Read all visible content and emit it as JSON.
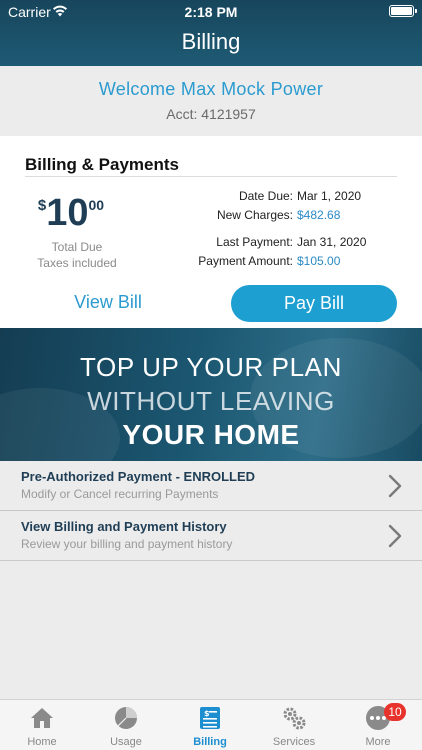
{
  "status_bar": {
    "carrier": "Carrier",
    "time": "2:18 PM"
  },
  "header": {
    "title": "Billing"
  },
  "welcome": {
    "name": "Welcome Max Mock Power",
    "account": "Acct: 4121957"
  },
  "billing": {
    "section_title": "Billing & Payments",
    "amount_currency": "$",
    "amount_dollars": "10",
    "amount_cents": "00",
    "total_due_label": "Total Due",
    "taxes_label": "Taxes included",
    "date_due_label": "Date Due:",
    "date_due_value": "Mar 1, 2020",
    "new_charges_label": "New Charges:",
    "new_charges_value": "$482.68",
    "last_payment_label": "Last Payment:",
    "last_payment_value": "Jan 31, 2020",
    "payment_amount_label": "Payment Amount:",
    "payment_amount_value": "$105.00",
    "view_bill_label": "View Bill",
    "pay_bill_label": "Pay Bill"
  },
  "banner": {
    "line1": "TOP UP YOUR PLAN",
    "line2": "WITHOUT LEAVING",
    "line3": "YOUR HOME"
  },
  "list": [
    {
      "title": "Pre-Authorized Payment - ENROLLED",
      "subtitle": "Modify or Cancel recurring Payments"
    },
    {
      "title": "View Billing and Payment History",
      "subtitle": "Review your billing and payment history"
    }
  ],
  "tabs": [
    {
      "label": "Home",
      "icon": "home-icon"
    },
    {
      "label": "Usage",
      "icon": "pie-chart-icon"
    },
    {
      "label": "Billing",
      "icon": "bill-icon",
      "active": true
    },
    {
      "label": "Services",
      "icon": "gears-icon"
    },
    {
      "label": "More",
      "icon": "more-icon",
      "badge": "10"
    }
  ],
  "colors": {
    "accent": "#1d9fd1",
    "header": "#1b4f66",
    "navy_text": "#1f3e55",
    "badge": "#e8322c"
  }
}
